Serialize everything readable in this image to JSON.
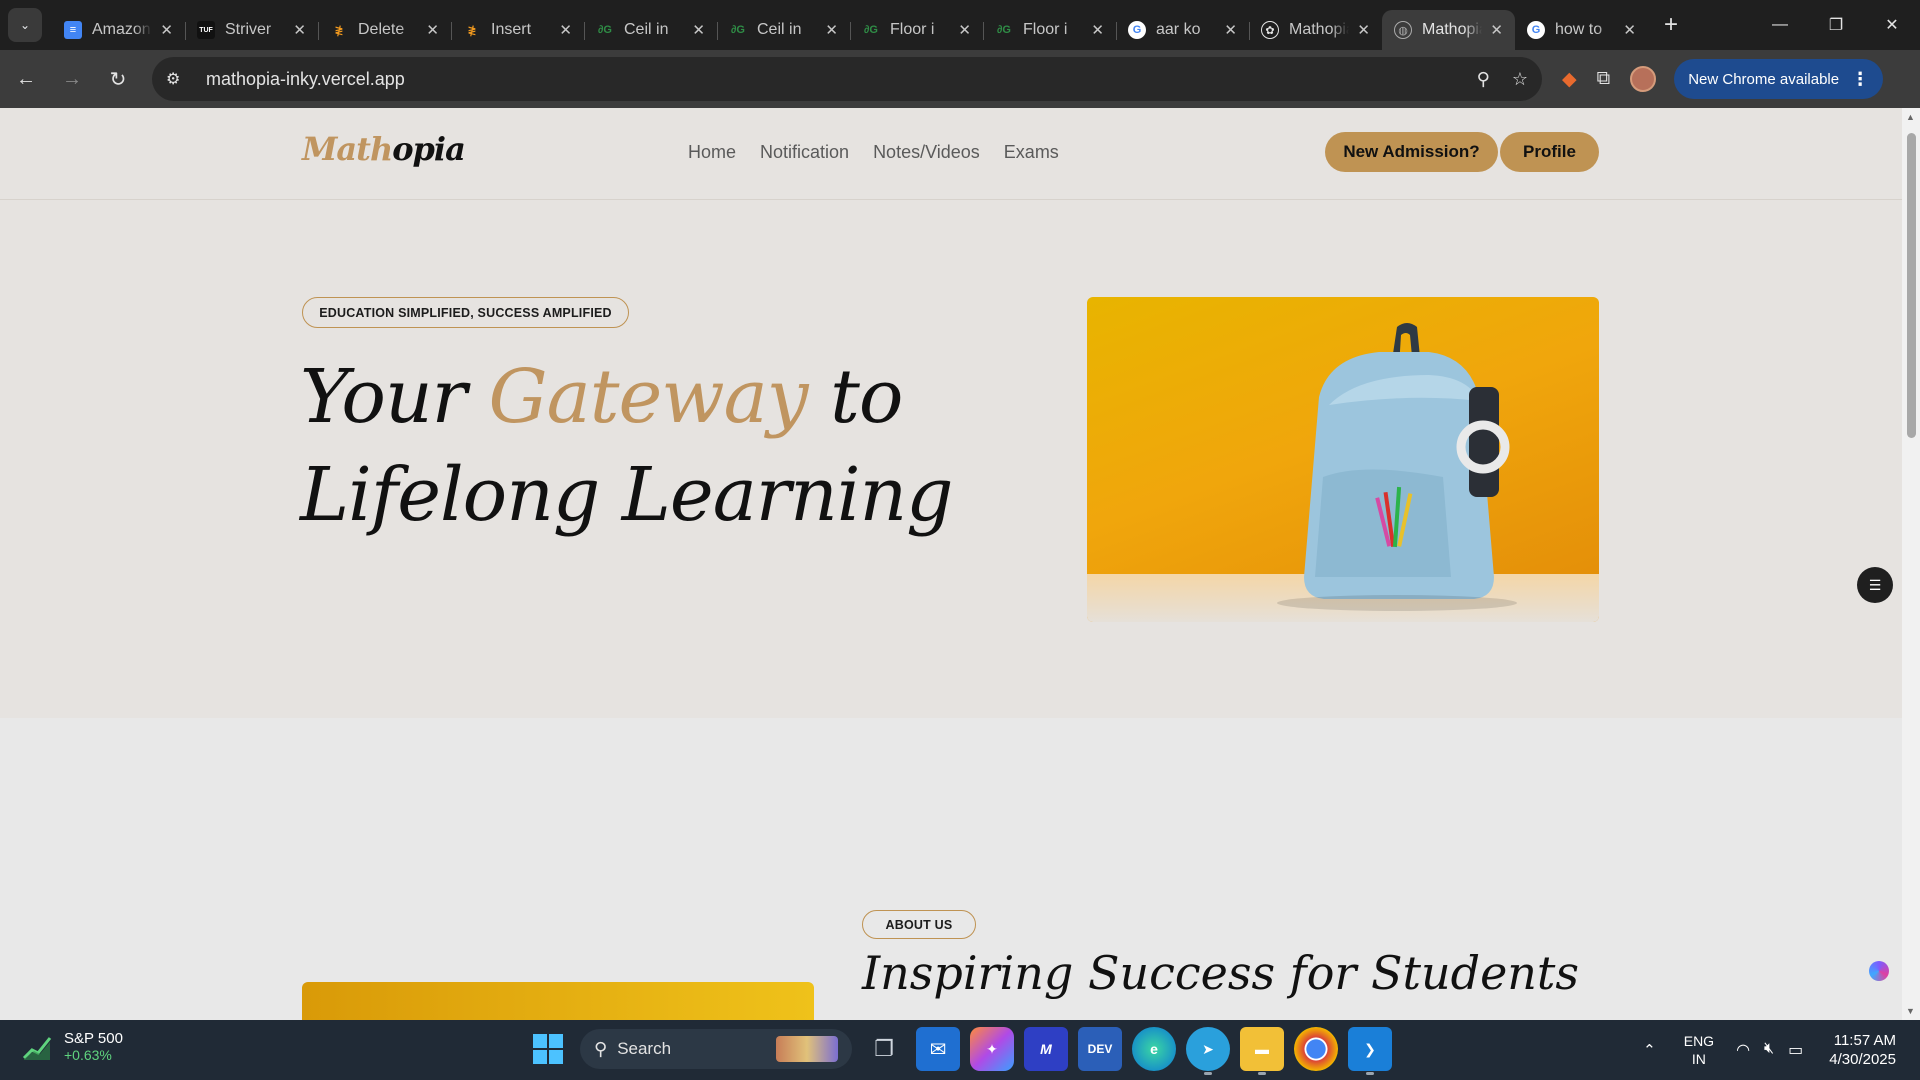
{
  "browser": {
    "tabs": [
      {
        "title": "Amazon",
        "favicon": "google-docs-icon",
        "active": false
      },
      {
        "title": "Striver",
        "favicon": "tuf-icon",
        "active": false
      },
      {
        "title": "Delete",
        "favicon": "codestudio-icon",
        "active": false
      },
      {
        "title": "Insert",
        "favicon": "codestudio-icon",
        "active": false
      },
      {
        "title": "Ceil in",
        "favicon": "geeksforgeeks-icon",
        "active": false
      },
      {
        "title": "Ceil in",
        "favicon": "geeksforgeeks-icon",
        "active": false
      },
      {
        "title": "Floor i",
        "favicon": "geeksforgeeks-icon",
        "active": false
      },
      {
        "title": "Floor i",
        "favicon": "geeksforgeeks-icon",
        "active": false
      },
      {
        "title": "aar ko",
        "favicon": "google-icon",
        "active": false
      },
      {
        "title": "Mathopia",
        "favicon": "chatgpt-icon",
        "active": false
      },
      {
        "title": "Mathopia",
        "favicon": "globe-icon",
        "active": true
      },
      {
        "title": "how to",
        "favicon": "google-icon",
        "active": false
      }
    ],
    "url": "mathopia-inky.vercel.app",
    "update_label": "New Chrome available"
  },
  "site": {
    "logo_part1": "Math",
    "logo_part2": "opia",
    "nav": [
      "Home",
      "Notification",
      "Notes/Videos",
      "Exams"
    ],
    "cta_admission": "New Admission?",
    "cta_profile": "Profile",
    "hero_badge": "EDUCATION SIMPLIFIED, SUCCESS AMPLIFIED",
    "hero_line1_a": "Your ",
    "hero_line1_b": "Gateway",
    "hero_line1_c": " to",
    "hero_line2": "Lifelong Learning",
    "about_badge": "ABOUT US",
    "about_title": "Inspiring Success for Students"
  },
  "taskbar": {
    "stock_name": "S&P 500",
    "stock_change": "+0.63%",
    "search_label": "Search",
    "lang_1": "ENG",
    "lang_2": "IN",
    "time": "11:57 AM",
    "date": "4/30/2025"
  }
}
